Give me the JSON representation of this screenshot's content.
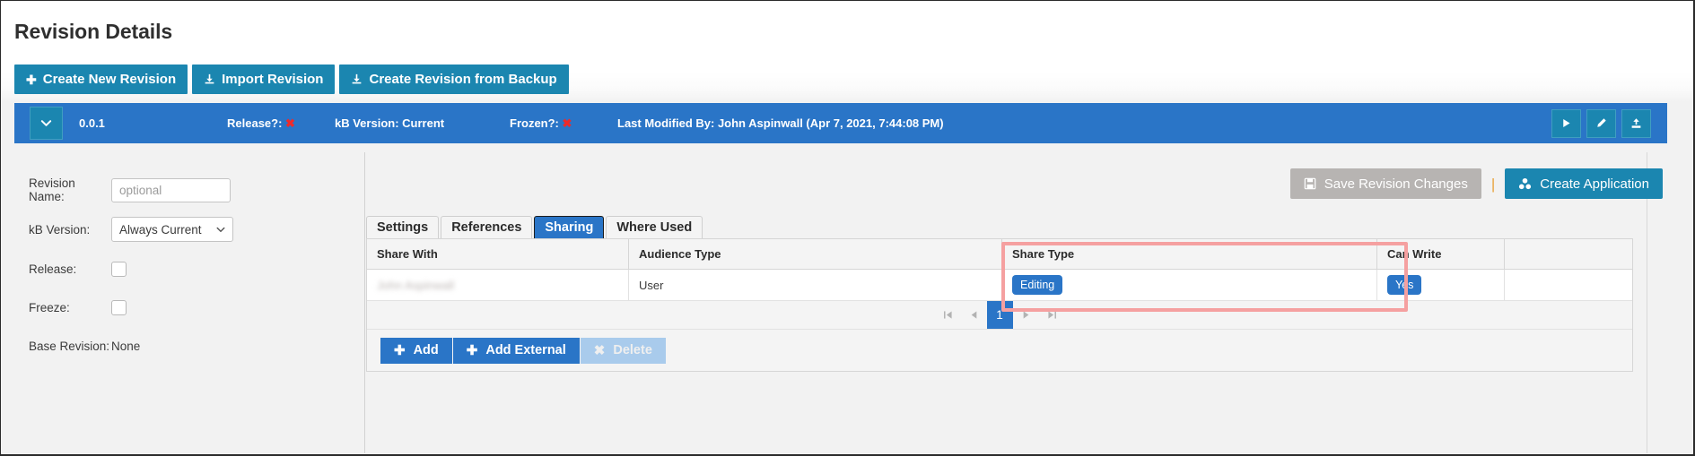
{
  "header": {
    "title": "Revision Details",
    "toolbar": [
      {
        "label": "Create New Revision",
        "icon": "plus-icon"
      },
      {
        "label": "Import Revision",
        "icon": "download-icon"
      },
      {
        "label": "Create Revision from Backup",
        "icon": "download-icon"
      }
    ]
  },
  "revision_banner": {
    "caret_icon": "chevron-down-icon",
    "version": "0.0.1",
    "release_label": "Release?:",
    "release_value": "✖",
    "kb_version_text": "kB Version: Current",
    "frozen_label": "Frozen?:",
    "frozen_value": "✖",
    "last_modified": "Last Modified By: John Aspinwall (Apr 7, 2021, 7:44:08 PM)",
    "actions": [
      {
        "name": "run-revision-button",
        "icon": "play-icon"
      },
      {
        "name": "edit-revision-button",
        "icon": "pencil-icon"
      },
      {
        "name": "export-revision-button",
        "icon": "upload-icon"
      }
    ],
    "accent_color": "#2a75c7",
    "action_color": "#1b86b0"
  },
  "form": {
    "revision_name_label": "Revision Name:",
    "revision_name_value": "",
    "revision_name_placeholder": "optional",
    "kb_version_label": "kB Version:",
    "kb_version_value": "Always Current",
    "kb_version_options": [
      "Always Current"
    ],
    "release_label": "Release:",
    "release_checked": false,
    "freeze_label": "Freeze:",
    "freeze_checked": false,
    "base_revision_label": "Base Revision:",
    "base_revision_value": "None"
  },
  "right_actions": {
    "save_label": "Save Revision Changes",
    "save_icon": "floppy-disk-icon",
    "save_disabled": true,
    "separator": "|",
    "create_app_label": "Create Application",
    "create_app_icon": "cubes-icon"
  },
  "tabs": [
    {
      "label": "Settings",
      "active": false
    },
    {
      "label": "References",
      "active": false
    },
    {
      "label": "Sharing",
      "active": true
    },
    {
      "label": "Where Used",
      "active": false
    }
  ],
  "grid": {
    "columns": [
      "Share With",
      "Audience Type",
      "Share Type",
      "Can Write"
    ],
    "rows": [
      {
        "share_with": "John Aspinwall",
        "share_with_redacted": true,
        "audience_type": "User",
        "share_type": "Editing",
        "can_write": "Yes"
      }
    ],
    "pager": {
      "first_icon": "first-page-icon",
      "prev_icon": "prev-page-icon",
      "current_page": "1",
      "next_icon": "next-page-icon",
      "last_icon": "last-page-icon"
    },
    "footer_buttons": [
      {
        "label": "Add",
        "icon": "plus-icon",
        "disabled": false
      },
      {
        "label": "Add External",
        "icon": "plus-icon",
        "disabled": false
      },
      {
        "label": "Delete",
        "icon": "times-icon",
        "disabled": true
      }
    ]
  },
  "annotation": {
    "highlight_color": "#f5a0a0",
    "highlight_target": "Share Type and Can Write columns"
  }
}
